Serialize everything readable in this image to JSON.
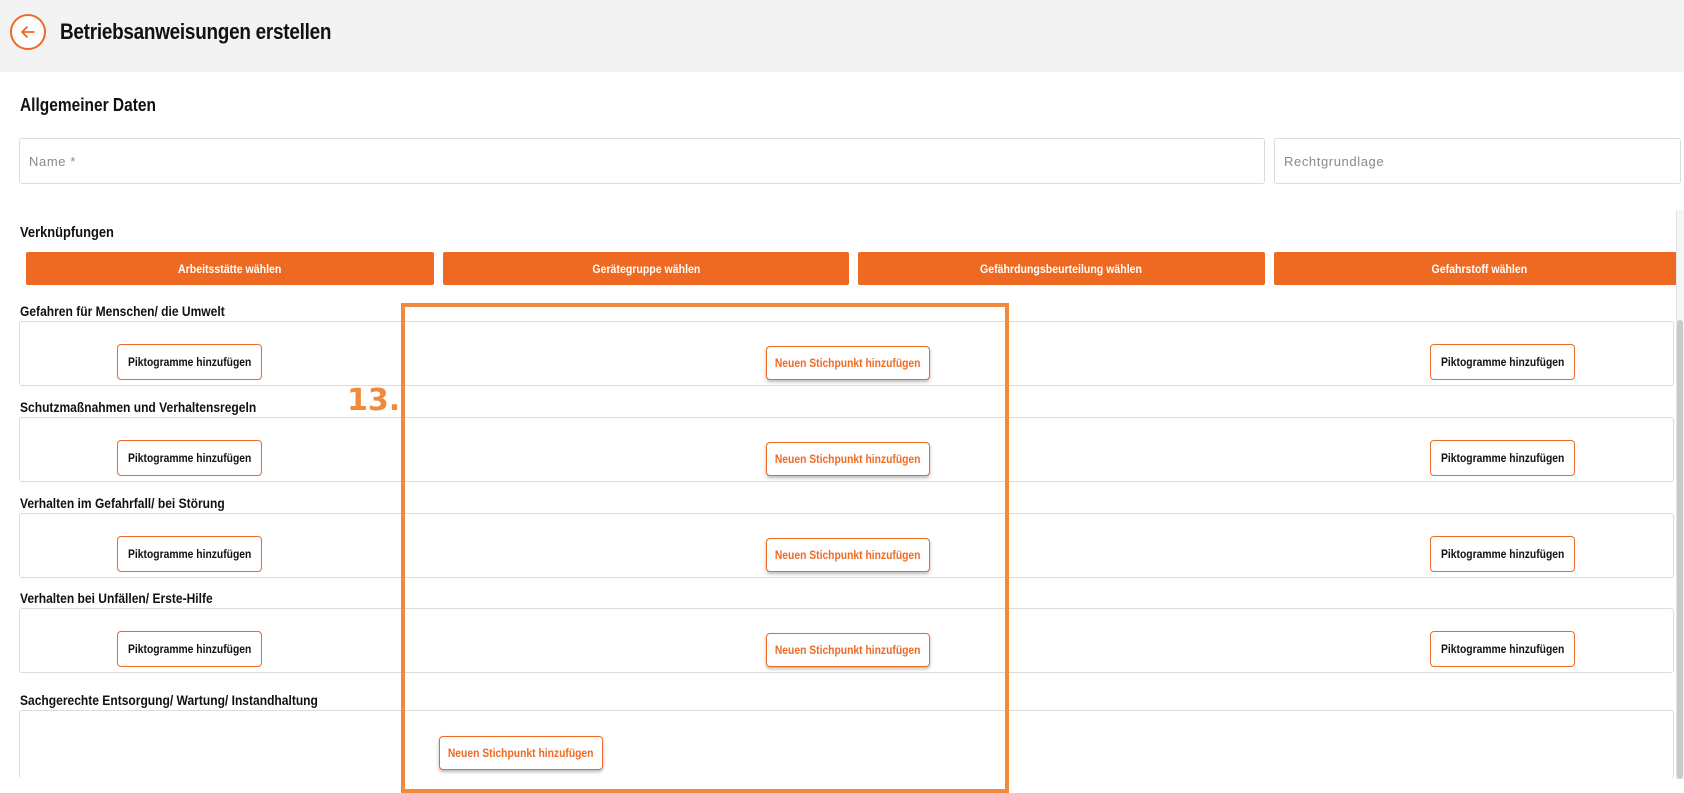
{
  "header": {
    "title": "Betriebsanweisungen erstellen",
    "back_icon": "arrow-left-icon",
    "accent_color": "#ee6a23"
  },
  "general": {
    "title": "Allgemeiner Daten",
    "name_placeholder": "Name *",
    "name_value": "",
    "recht_placeholder": "Rechtgrundlage",
    "recht_value": ""
  },
  "links": {
    "title": "Verknüpfungen",
    "buttons": [
      "Arbeitsstätte wählen",
      "Gerätegruppe wählen",
      "Gefährdungsbeurteilung wählen",
      "Gefahrstoff wählen"
    ]
  },
  "sections": [
    {
      "label": "Gefahren für Menschen/ die Umwelt",
      "left_button": "Piktogramme hinzufügen",
      "center_button": "Neuen Stichpunkt hinzufügen",
      "right_button": "Piktogramme hinzufügen"
    },
    {
      "label": "Schutzmaßnahmen und Verhaltensregeln",
      "left_button": "Piktogramme hinzufügen",
      "center_button": "Neuen Stichpunkt hinzufügen",
      "right_button": "Piktogramme hinzufügen"
    },
    {
      "label": "Verhalten im Gefahrfall/ bei Störung",
      "left_button": "Piktogramme hinzufügen",
      "center_button": "Neuen Stichpunkt hinzufügen",
      "right_button": "Piktogramme hinzufügen"
    },
    {
      "label": "Verhalten bei Unfällen/ Erste-Hilfe",
      "left_button": "Piktogramme hinzufügen",
      "center_button": "Neuen Stichpunkt hinzufügen",
      "right_button": "Piktogramme hinzufügen"
    },
    {
      "label": "Sachgerechte Entsorgung/ Wartung/ Instandhaltung",
      "center_button": "Neuen Stichpunkt hinzufügen"
    }
  ],
  "annotation": {
    "step_label": "13.",
    "color": "#f08a3c"
  }
}
